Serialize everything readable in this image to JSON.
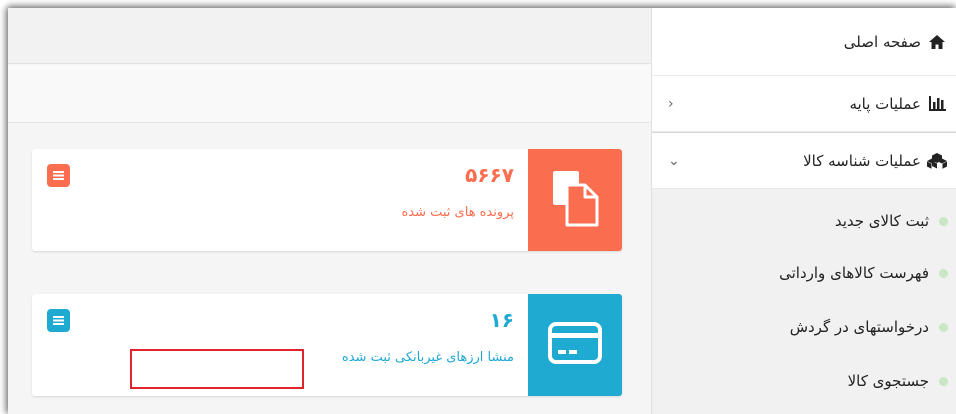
{
  "sidebar": {
    "home": {
      "label": "صفحه اصلی",
      "icon": "home-icon"
    },
    "base_ops": {
      "label": "عملیات پایه",
      "icon": "bar-chart-icon",
      "chevron": "›"
    },
    "product_ops": {
      "label": "عملیات شناسه کالا",
      "icon": "cubes-icon",
      "chevron": "⌄"
    },
    "sub_items": [
      {
        "label": "ثبت کالای جدید"
      },
      {
        "label": "فهرست کالاهای وارداتی"
      },
      {
        "label": "درخواستهای در گردش"
      },
      {
        "label": "جستجوی کالا"
      }
    ]
  },
  "cards": [
    {
      "value": "۵۶۶۷",
      "label": "پرونده های ثبت شده",
      "color": "#fb6d4f",
      "icon": "copy-files-icon"
    },
    {
      "value": "۱۶",
      "label": "منشا ارزهای غیربانکی ثبت شده",
      "color": "#1faad2",
      "icon": "credit-card-icon"
    }
  ],
  "colors": {
    "highlight": "#e0242a",
    "dot": "#c9e6c5"
  }
}
